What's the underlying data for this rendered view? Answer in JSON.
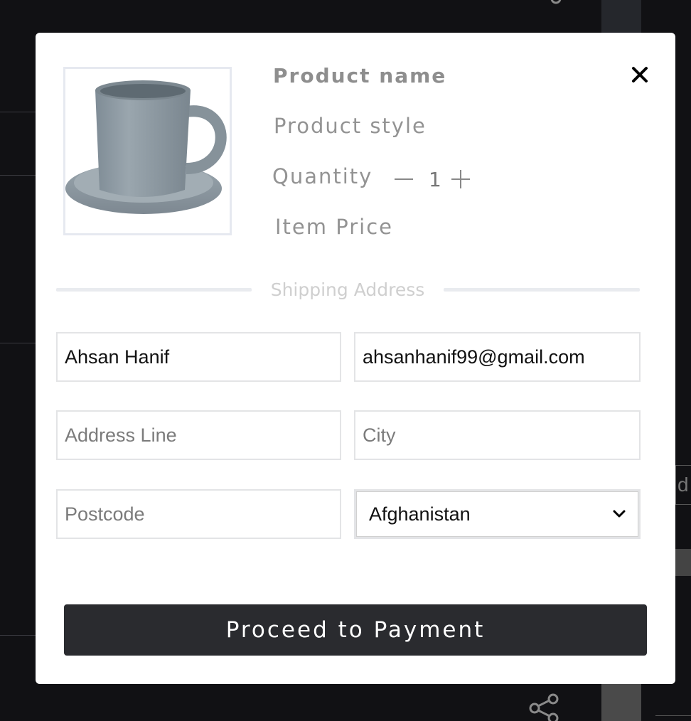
{
  "product": {
    "name_label": "Product name",
    "style_label": "Product style",
    "quantity_label": "Quantity",
    "quantity_value": "1",
    "price_label": "Item Price"
  },
  "shipping": {
    "section_title": "Shipping Address",
    "full_name_value": "Ahsan Hanif",
    "email_value": "ahsanhanif99@gmail.com",
    "address_placeholder": "Address Line",
    "city_placeholder": "City",
    "postcode_placeholder": "Postcode",
    "country_selected": "Afghanistan"
  },
  "actions": {
    "proceed_label": "Proceed to Payment"
  },
  "background": {
    "partial_text": "d"
  },
  "icons": {
    "close": "close-icon",
    "minus": "minus-icon",
    "plus": "plus-icon",
    "dropdown": "chevron-down-icon",
    "share": "share-icon"
  },
  "colors": {
    "overlay": "#111114",
    "modal_bg": "#ffffff",
    "button_bg": "#2a2b2f",
    "label_gray": "#8e8e8e"
  }
}
